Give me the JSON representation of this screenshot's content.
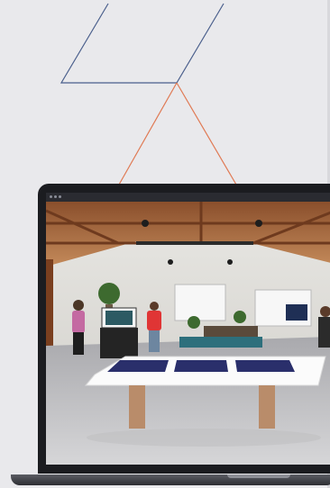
{
  "window": {
    "controls": [
      "dot",
      "dot",
      "dot"
    ]
  },
  "scene": {
    "description_icon": "showroom-3d-scene-icon"
  },
  "colors": {
    "background": "#e9e9ec",
    "accent_line_blue": "#4a5f8c",
    "accent_line_orange": "#e07a54",
    "laptop_frame": "#1b1c20"
  }
}
